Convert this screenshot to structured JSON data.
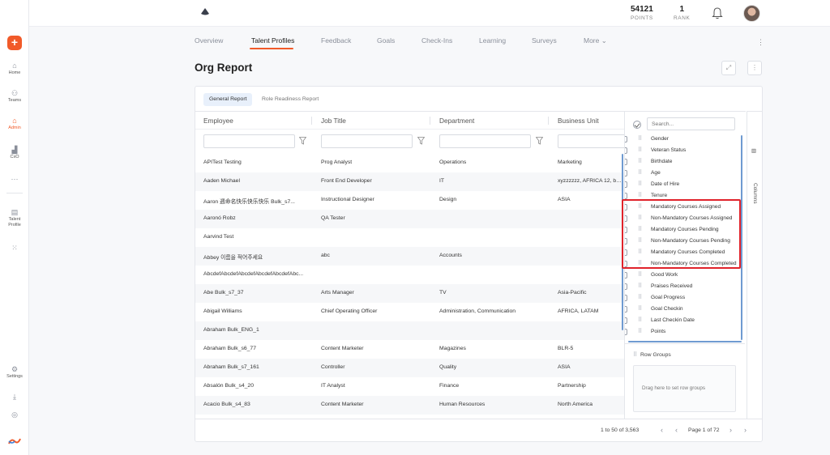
{
  "rail": {
    "items": [
      {
        "label": "Home",
        "icon": "home-icon"
      },
      {
        "label": "Teams",
        "icon": "teams-icon"
      },
      {
        "label": "Admin",
        "icon": "admin-icon"
      },
      {
        "label": "CxO",
        "icon": "chart-icon"
      },
      {
        "label": "···",
        "icon": "more-icon"
      },
      {
        "label": "Talent Profile",
        "icon": "talent-profile-icon"
      },
      {
        "label": "Settings",
        "icon": "settings-icon"
      }
    ],
    "accent": "#f15a29"
  },
  "header": {
    "points_value": "54121",
    "points_label": "POINTS",
    "rank_value": "1",
    "rank_label": "RANK"
  },
  "tabs": [
    "Overview",
    "Talent Profiles",
    "Feedback",
    "Goals",
    "Check-Ins",
    "Learning",
    "Surveys",
    "More ⌄"
  ],
  "page_title": "Org Report",
  "report_tabs": [
    "General Report",
    "Role Readiness Report"
  ],
  "grid": {
    "columns": [
      "Employee",
      "Job Title",
      "Department",
      "Business Unit"
    ],
    "rows": [
      [
        "APITest Testing",
        "Prog Analyst",
        "Operations",
        "Marketing"
      ],
      [
        "Aaden Michael",
        "Front End Developer",
        "IT",
        "xyzzzzzz, AFRICA 12, busi"
      ],
      [
        "Aaron 週命名快乐快乐快乐 Bulk_s7...",
        "Instructional Designer",
        "Design",
        "ASIA"
      ],
      [
        "Aaronó Robz",
        "QA Tester",
        "",
        ""
      ],
      [
        "Aarvind Test",
        "",
        "",
        ""
      ],
      [
        "Abbey 이름을 적어주세요",
        "abc",
        "Accounts",
        ""
      ],
      [
        "AbcdefAbcdefAbcdefAbcdefAbcdefAbc...",
        "",
        "",
        ""
      ],
      [
        "Abe Bulk_s7_37",
        "Arts Manager",
        "TV",
        "Asia-Pacific"
      ],
      [
        "Abigail Williams",
        "Chief Operating Officer",
        "Administration, Communication",
        "AFRICA, LATAM"
      ],
      [
        "Abraham Bulk_ENG_1",
        "",
        "",
        ""
      ],
      [
        "Abraham Bulk_s6_77",
        "Content Marketer",
        "Magazines",
        "BLR-5"
      ],
      [
        "Abraham Bulk_s7_161",
        "Controller",
        "Quality",
        "ASIA"
      ],
      [
        "Absalón Bulk_s4_20",
        "IT Analyst",
        "Finance",
        "Partnership"
      ],
      [
        "Acacio Bulk_s4_83",
        "Content Marketer",
        "Human Resources",
        "North America"
      ]
    ]
  },
  "column_panel": {
    "search_placeholder": "Search...",
    "items": [
      "Gender",
      "Veteran Status",
      "Birthdate",
      "Age",
      "Date of Hire",
      "Tenure",
      "Mandatory Courses Assigned",
      "Non-Mandatory Courses Assigned",
      "Mandatory Courses Pending",
      "Non-Mandatory Courses Pending",
      "Mandatory Courses Completed",
      "Non-Mandatory Courses Completed",
      "Good Work",
      "Praises Received",
      "Goal Progress",
      "Goal Checkin",
      "Last Checkin Date",
      "Points"
    ],
    "row_groups_label": "Row Groups",
    "row_groups_hint": "Drag here to set row groups",
    "side_tab_label": "Columns"
  },
  "pager": {
    "range": "1 to 50 of 3,563",
    "page": "Page 1 of 72"
  }
}
